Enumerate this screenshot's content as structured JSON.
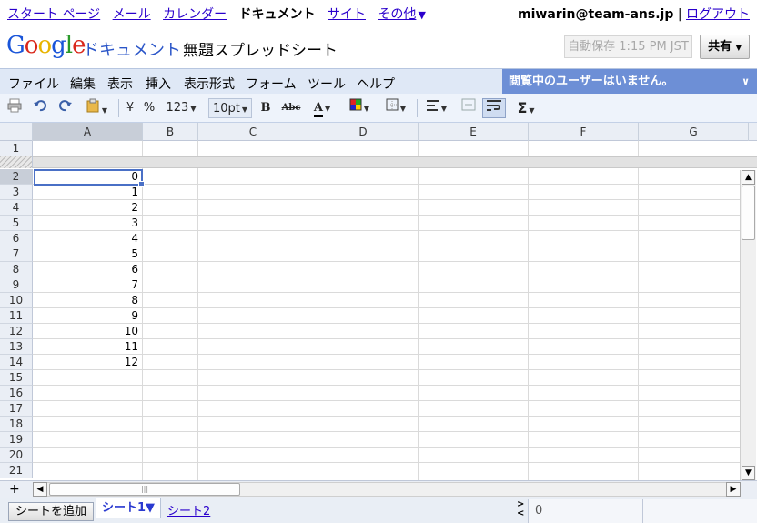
{
  "topnav": {
    "links": [
      "スタート ページ",
      "メール",
      "カレンダー"
    ],
    "current": "ドキュメント",
    "links2": [
      "サイト",
      "その他"
    ],
    "more_arrow": "▼",
    "user_email": "miwarin@team-ans.jp",
    "separator": "|",
    "logout": "ログアウト"
  },
  "header": {
    "logo": [
      "G",
      "o",
      "o",
      "g",
      "l",
      "e"
    ],
    "product": "ドキュメント",
    "doc_title": "無題スプレッドシート",
    "autosave": "自動保存 1:15 PM JST",
    "share": "共有"
  },
  "menu": {
    "items": [
      "ファイル",
      "編集",
      "表示",
      "挿入",
      "表示形式",
      "フォーム",
      "ツール",
      "ヘルプ"
    ],
    "viewers_notice": "閲覧中のユーザーはいません。"
  },
  "toolbar": {
    "currency": "¥",
    "percent": "%",
    "number_format": "123",
    "font_size": "10pt",
    "bold": "B",
    "strike": "Abc",
    "text_color": "A",
    "sum": "Σ"
  },
  "grid": {
    "columns": [
      "A",
      "B",
      "C",
      "D",
      "E",
      "F",
      "G"
    ],
    "selected_column": "A",
    "rows": [
      "1",
      "2",
      "3",
      "4",
      "5",
      "6",
      "7",
      "8",
      "9",
      "10",
      "11",
      "12",
      "13",
      "14",
      "15",
      "16",
      "17",
      "18",
      "19",
      "20",
      "21"
    ],
    "selected_row": "2",
    "column_a_values": [
      "0",
      "1",
      "2",
      "3",
      "4",
      "5",
      "6",
      "7",
      "8",
      "9",
      "10",
      "11",
      "12"
    ]
  },
  "bottom": {
    "add_row": "+",
    "add_sheet": "シートを追加",
    "sheets": [
      "シート1",
      "シート2"
    ],
    "active_sheet_arrow": "▼",
    "formula_value": "0"
  },
  "colors": {
    "accent": "#6d8fd6",
    "link": "#2a00cc",
    "menubar": "#dfe8f6",
    "selection": "#4a70c6"
  }
}
